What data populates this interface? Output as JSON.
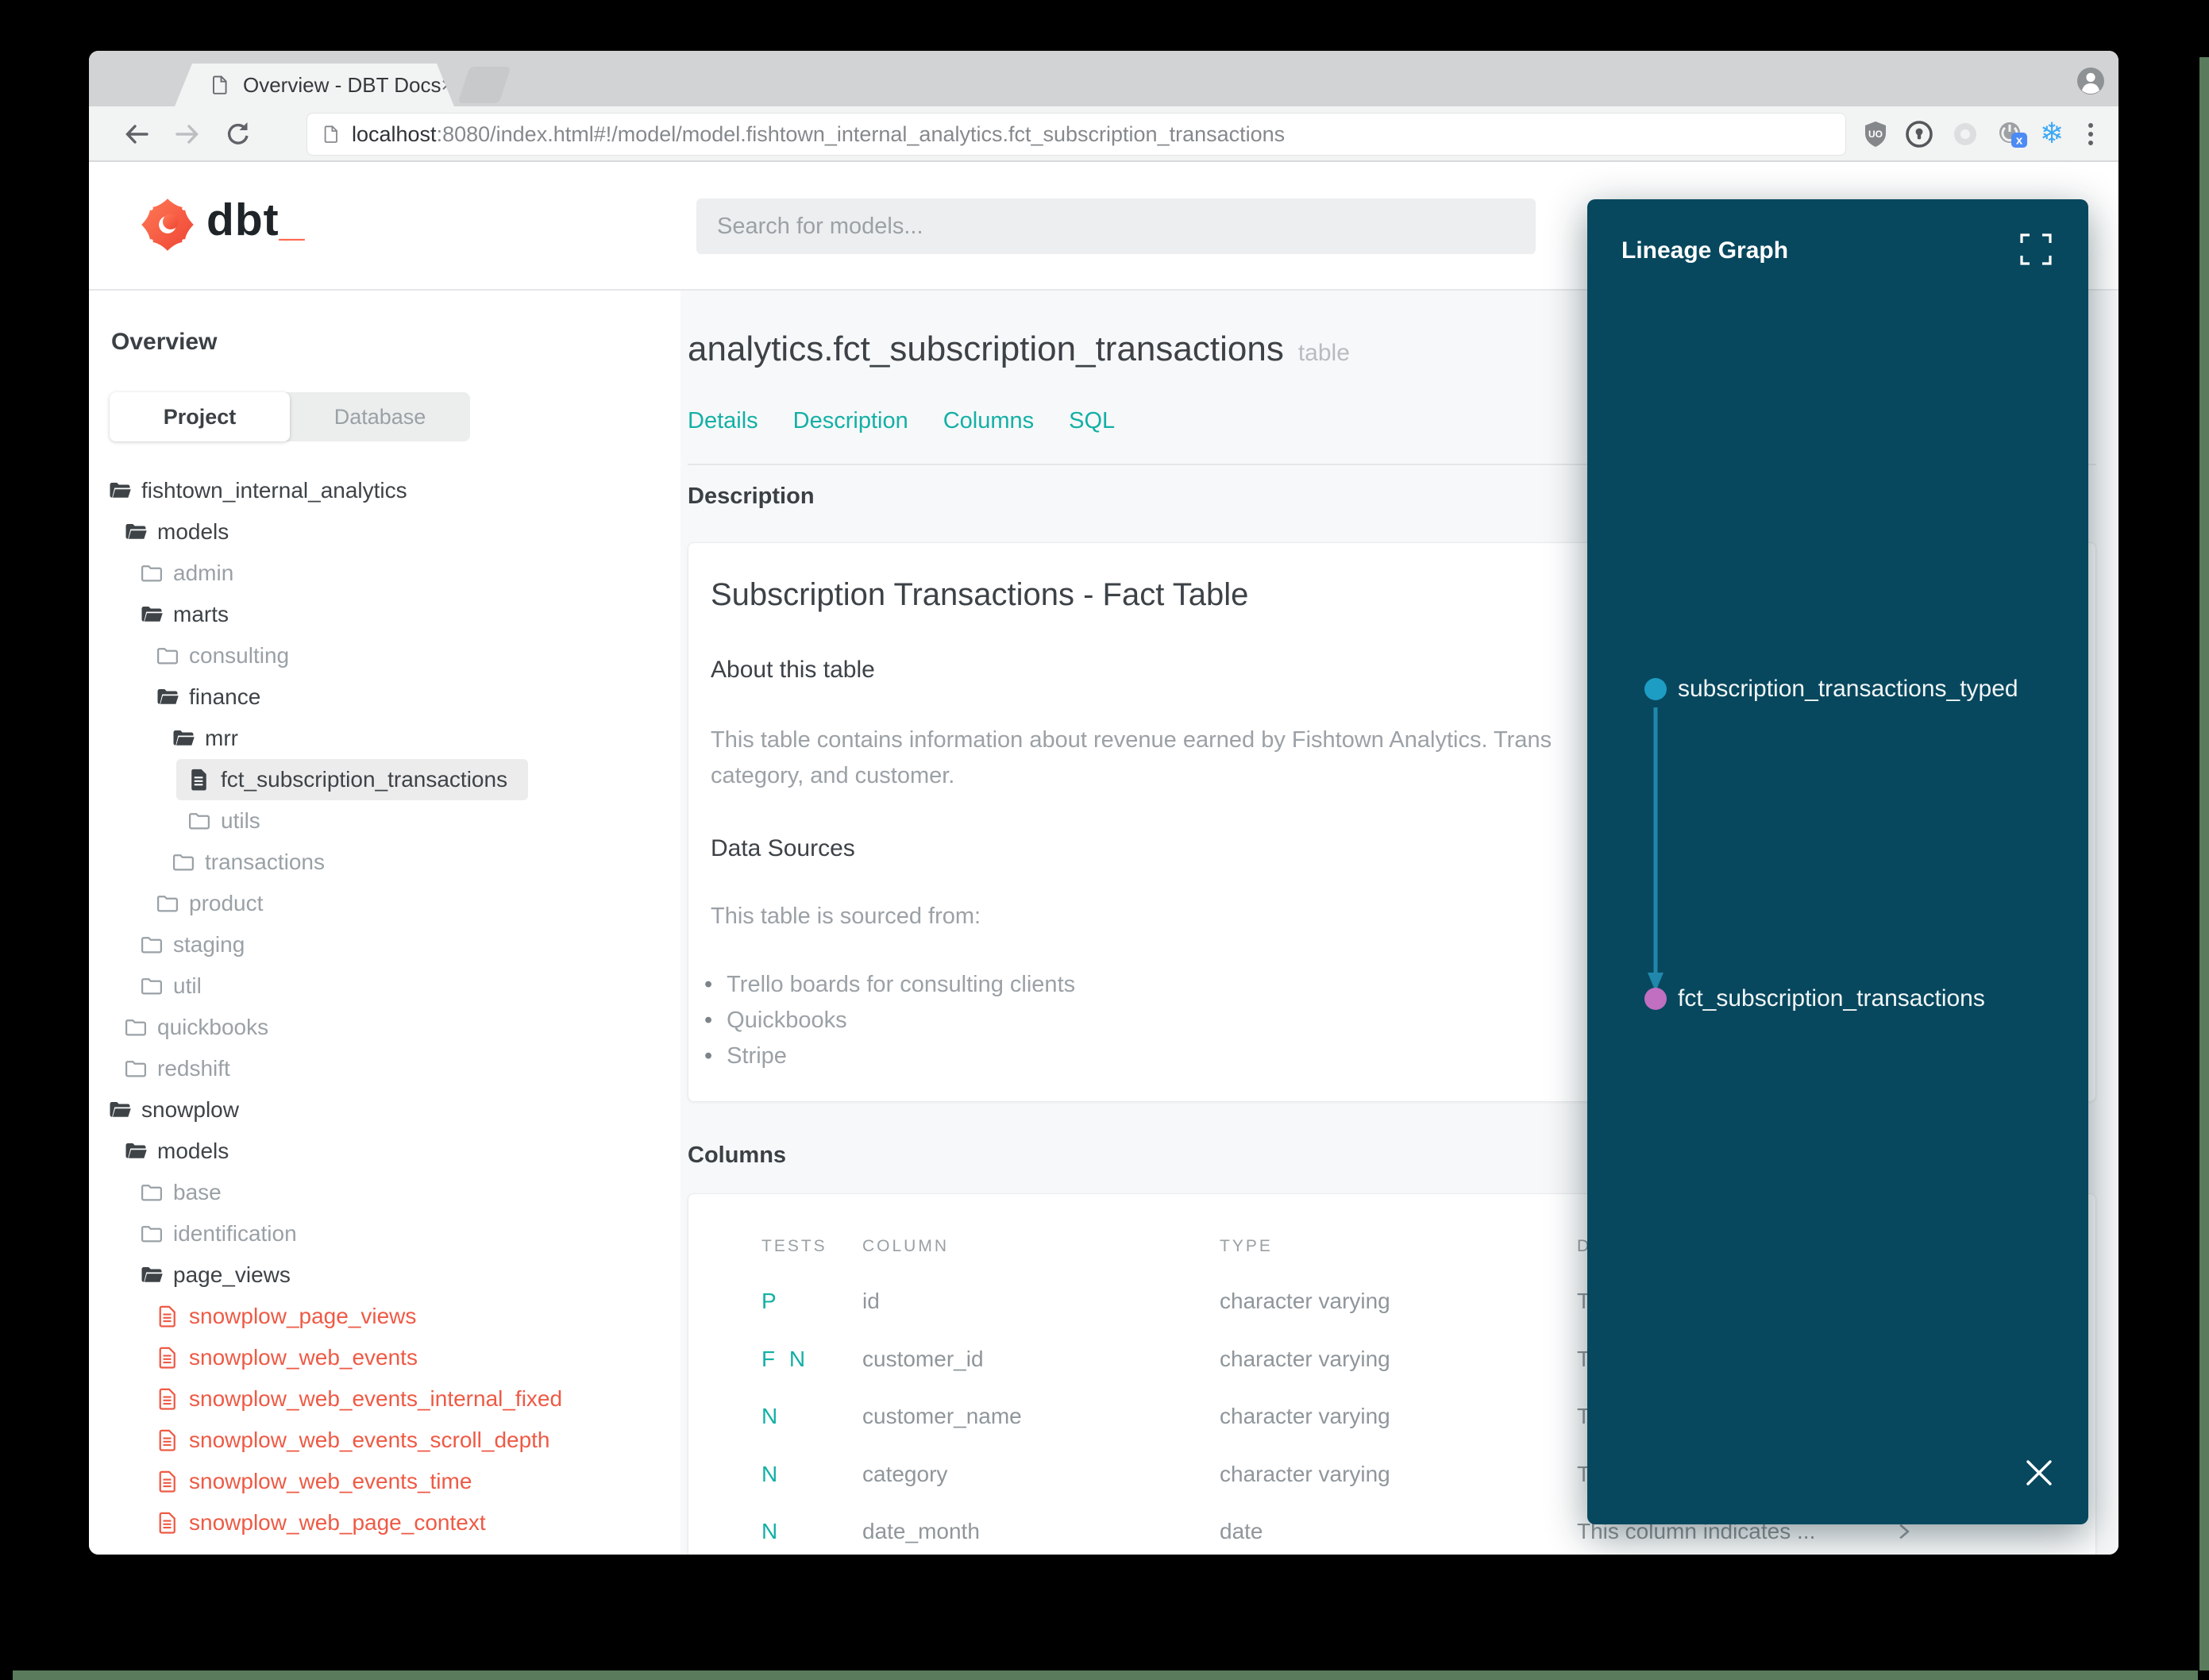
{
  "window": {
    "tab_title": "Overview - DBT Docs",
    "tab_close": "×",
    "url_host": "localhost",
    "url_rest": ":8080/index.html#!/model/model.fishtown_internal_analytics.fct_subscription_transactions"
  },
  "header": {
    "logo_text": "dbt",
    "logo_underscore": "_",
    "search_placeholder": "Search for models..."
  },
  "sidebar": {
    "title": "Overview",
    "tabs": {
      "project": "Project",
      "database": "Database"
    },
    "tree": [
      {
        "label": "fishtown_internal_analytics",
        "level": 0,
        "icon": "folder-open",
        "tone": "dark",
        "selected": false
      },
      {
        "label": "models",
        "level": 1,
        "icon": "folder-open",
        "tone": "dark",
        "selected": false
      },
      {
        "label": "admin",
        "level": 2,
        "icon": "folder-closed",
        "tone": "gray",
        "selected": false
      },
      {
        "label": "marts",
        "level": 2,
        "icon": "folder-open",
        "tone": "dark",
        "selected": false
      },
      {
        "label": "consulting",
        "level": 3,
        "icon": "folder-closed",
        "tone": "gray",
        "selected": false
      },
      {
        "label": "finance",
        "level": 3,
        "icon": "folder-open",
        "tone": "dark",
        "selected": false
      },
      {
        "label": "mrr",
        "level": 4,
        "icon": "folder-open",
        "tone": "dark",
        "selected": false
      },
      {
        "label": "fct_subscription_transactions",
        "level": 5,
        "icon": "file-solid",
        "tone": "dark",
        "selected": true
      },
      {
        "label": "utils",
        "level": 5,
        "icon": "folder-closed",
        "tone": "gray",
        "selected": false
      },
      {
        "label": "transactions",
        "level": 4,
        "icon": "folder-closed",
        "tone": "gray",
        "selected": false
      },
      {
        "label": "product",
        "level": 3,
        "icon": "folder-closed",
        "tone": "gray",
        "selected": false
      },
      {
        "label": "staging",
        "level": 2,
        "icon": "folder-closed",
        "tone": "gray",
        "selected": false
      },
      {
        "label": "util",
        "level": 2,
        "icon": "folder-closed",
        "tone": "gray",
        "selected": false
      },
      {
        "label": "quickbooks",
        "level": 1,
        "icon": "folder-closed",
        "tone": "gray",
        "selected": false
      },
      {
        "label": "redshift",
        "level": 1,
        "icon": "folder-closed",
        "tone": "gray",
        "selected": false
      },
      {
        "label": "snowplow",
        "level": 0,
        "icon": "folder-open",
        "tone": "dark",
        "selected": false
      },
      {
        "label": "models",
        "level": 1,
        "icon": "folder-open",
        "tone": "dark",
        "selected": false
      },
      {
        "label": "base",
        "level": 2,
        "icon": "folder-closed",
        "tone": "gray",
        "selected": false
      },
      {
        "label": "identification",
        "level": 2,
        "icon": "folder-closed",
        "tone": "gray",
        "selected": false
      },
      {
        "label": "page_views",
        "level": 2,
        "icon": "folder-open",
        "tone": "dark",
        "selected": false
      },
      {
        "label": "snowplow_page_views",
        "level": 3,
        "icon": "file-red",
        "tone": "red",
        "selected": false
      },
      {
        "label": "snowplow_web_events",
        "level": 3,
        "icon": "file-red",
        "tone": "red",
        "selected": false
      },
      {
        "label": "snowplow_web_events_internal_fixed",
        "level": 3,
        "icon": "file-red",
        "tone": "red",
        "selected": false
      },
      {
        "label": "snowplow_web_events_scroll_depth",
        "level": 3,
        "icon": "file-red",
        "tone": "red",
        "selected": false
      },
      {
        "label": "snowplow_web_events_time",
        "level": 3,
        "icon": "file-red",
        "tone": "red",
        "selected": false
      },
      {
        "label": "snowplow_web_page_context",
        "level": 3,
        "icon": "file-red",
        "tone": "red",
        "selected": false
      }
    ]
  },
  "doc": {
    "title": "analytics.fct_subscription_transactions",
    "badge": "table",
    "nav": [
      "Details",
      "Description",
      "Columns",
      "SQL"
    ],
    "description_heading": "Description",
    "card": {
      "title": "Subscription Transactions - Fact Table",
      "about_heading": "About this table",
      "about_line1": "This table contains information about revenue earned by Fishtown Analytics. Trans",
      "about_line2": "category, and customer.",
      "sources_heading": "Data Sources",
      "sources_intro": "This table is sourced from:",
      "sources": [
        "Trello boards for consulting clients",
        "Quickbooks",
        "Stripe"
      ]
    },
    "columns_heading": "Columns",
    "table": {
      "headers": [
        "TESTS",
        "COLUMN",
        "TYPE",
        "D"
      ],
      "rows": [
        {
          "tests": "P",
          "column": "id",
          "type": "character varying",
          "description": "T",
          "chevron": false
        },
        {
          "tests": "F N",
          "column": "customer_id",
          "type": "character varying",
          "description": "T",
          "chevron": false
        },
        {
          "tests": "N",
          "column": "customer_name",
          "type": "character varying",
          "description": "T",
          "chevron": false
        },
        {
          "tests": "N",
          "column": "category",
          "type": "character varying",
          "description": "T",
          "chevron": false
        },
        {
          "tests": "N",
          "column": "date_month",
          "type": "date",
          "description": "This column indicates ...",
          "chevron": true
        }
      ]
    }
  },
  "lineage": {
    "title": "Lineage Graph",
    "panel_color": "#07485e",
    "arrow_color": "#2187ac",
    "nodes": [
      {
        "label": "subscription_transactions_typed",
        "color": "#1d9dc4"
      },
      {
        "label": "fct_subscription_transactions",
        "color": "#c16fc0"
      }
    ]
  },
  "colors": {
    "accent_teal": "#13b0a6",
    "sidebar_red": "#ee5a45",
    "dbt_orange": "#ff6a50",
    "desktop_green": "#5a7c5c"
  }
}
